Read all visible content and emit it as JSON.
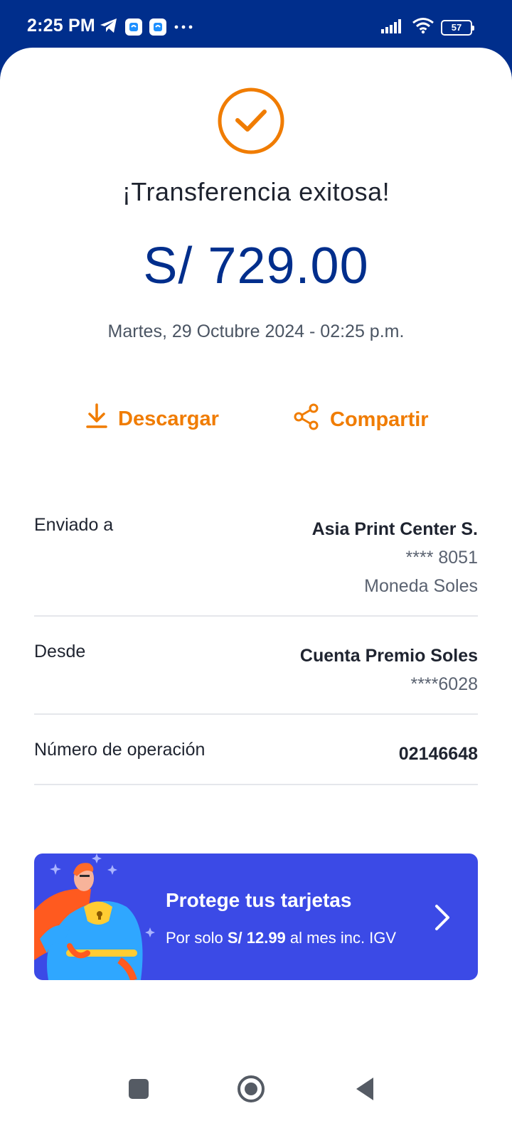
{
  "status_bar": {
    "time": "2:25 PM",
    "battery": "57",
    "icons": [
      "telegram-icon",
      "app-notification-icon",
      "app-notification-icon",
      "more-dots-icon",
      "signal-icon",
      "wifi-icon",
      "battery-icon"
    ]
  },
  "receipt": {
    "title": "¡Transferencia exitosa!",
    "amount": "S/ 729.00",
    "datetime": "Martes, 29 Octubre 2024 - 02:25 p.m.",
    "success_icon": "check-circle-icon"
  },
  "actions": {
    "download_label": "Descargar",
    "share_label": "Compartir"
  },
  "details": {
    "sent_to": {
      "label": "Enviado a",
      "name": "Asia Print Center S.",
      "account": "**** 8051",
      "currency": "Moneda Soles"
    },
    "from": {
      "label": "Desde",
      "account_name": "Cuenta Premio Soles",
      "account_number": "****6028"
    },
    "operation": {
      "label": "Número de operación",
      "value": "02146648"
    }
  },
  "promo": {
    "title": "Protege tus tarjetas",
    "sub_prefix": "Por solo",
    "sub_price": "S/ 12.99",
    "sub_suffix": "al mes inc. IGV"
  },
  "colors": {
    "brand_blue": "#002e8c",
    "accent_orange": "#f07c00",
    "promo_blue": "#3b4ae6"
  }
}
